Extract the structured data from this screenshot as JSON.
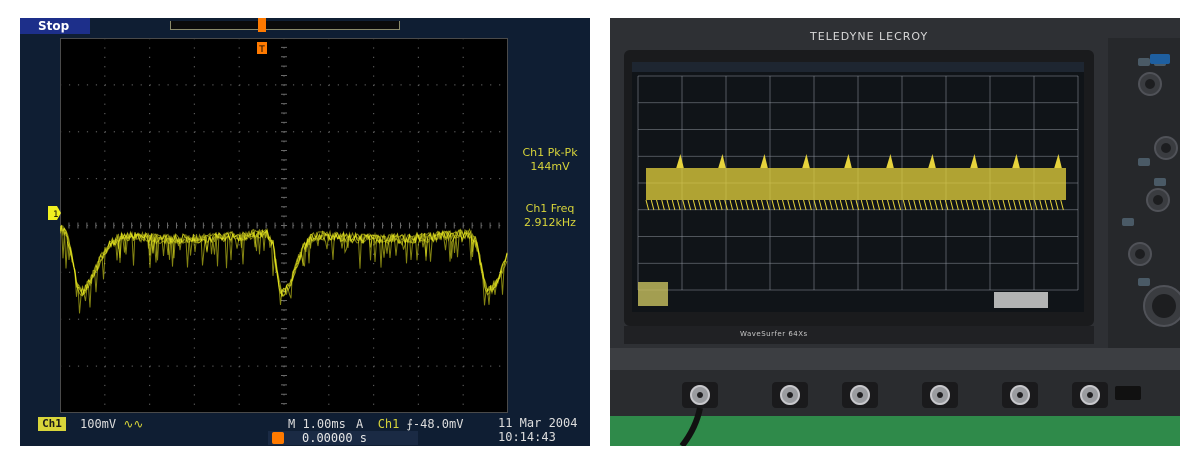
{
  "left_scope": {
    "status": "Stop",
    "measurements": [
      {
        "label": "Ch1 Pk-Pk",
        "value": "144mV"
      },
      {
        "label": "Ch1 Freq",
        "value": "2.912kHz"
      }
    ],
    "channel_badge": "Ch1",
    "vertical_scale": "100mV",
    "coupling_symbol": "∿∿",
    "timebase": "M 1.00ms",
    "trigger_mode": "A",
    "trigger_channel": "Ch1",
    "trigger_slope_symbol": "⨍",
    "trigger_level": "-48.0mV",
    "trigger_position": "0.00000 s",
    "date": "11 Mar 2004",
    "time": "10:14:43",
    "trace_color": "#f0f020",
    "marker_color": "#ff7a00"
  },
  "right_photo": {
    "brand": "TELEDYNE LECROY",
    "model": "WaveSurfer 64Xs",
    "trace_color": "#e6d33c"
  }
}
